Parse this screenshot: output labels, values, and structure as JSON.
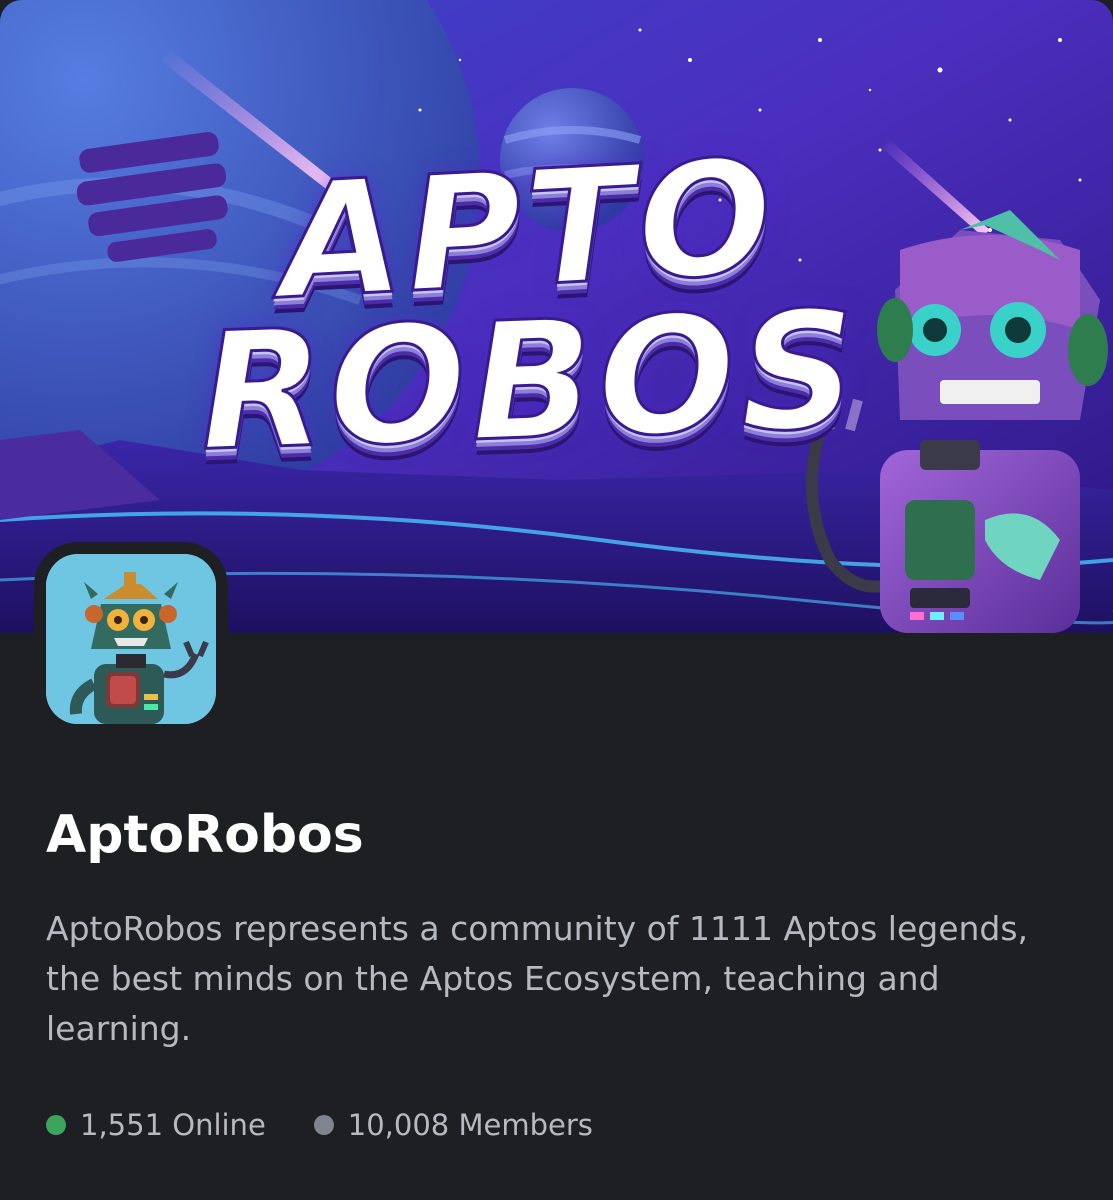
{
  "banner": {
    "title_line_1": "APTO",
    "title_line_2": "ROBOS"
  },
  "server": {
    "name": "AptoRobos",
    "description": "AptoRobos represents a community of 1111 Aptos legends, the best minds on the Aptos Ecosystem, teaching and learning."
  },
  "stats": {
    "online": {
      "text": "1,551 Online",
      "color": "#3ba55d"
    },
    "members": {
      "text": "10,008 Members",
      "color": "#80848e"
    }
  },
  "colors": {
    "background": "#1e1f22",
    "name_text": "#ffffff",
    "body_text": "#b5bac1"
  }
}
